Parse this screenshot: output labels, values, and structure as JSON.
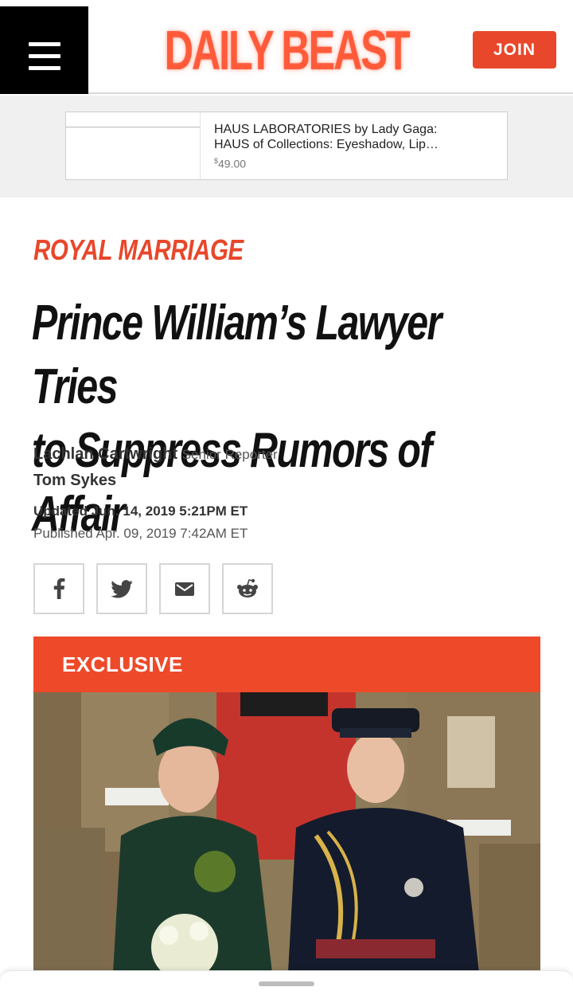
{
  "header": {
    "logo_text": "DAILY BEAST",
    "join_label": "JOIN",
    "menu_icon": "hamburger-menu-icon",
    "brand_color": "#e8472b"
  },
  "ad": {
    "title_line1": "HAUS LABORATORIES by Lady Gaga:",
    "title_line2": "HAUS of Collections: Eyeshadow, Lip…",
    "price_symbol": "$",
    "price": "49.00"
  },
  "article": {
    "kicker": "ROYAL MARRIAGE",
    "headline_line1": "Prince William’s Lawyer Tries",
    "headline_line2": "to Suppress Rumors of Affair",
    "authors": [
      {
        "name": "Lachlan Cartwright",
        "role": "Senior Reporter"
      },
      {
        "name": "Tom Sykes",
        "role": ""
      }
    ],
    "updated": "Updated Jun. 14, 2019 5:21PM ET",
    "published": "Published Apr. 09, 2019 7:42AM ET",
    "share": [
      {
        "icon": "facebook-icon"
      },
      {
        "icon": "twitter-icon"
      },
      {
        "icon": "email-icon"
      },
      {
        "icon": "reddit-icon"
      }
    ],
    "exclusive_label": "EXCLUSIVE"
  }
}
